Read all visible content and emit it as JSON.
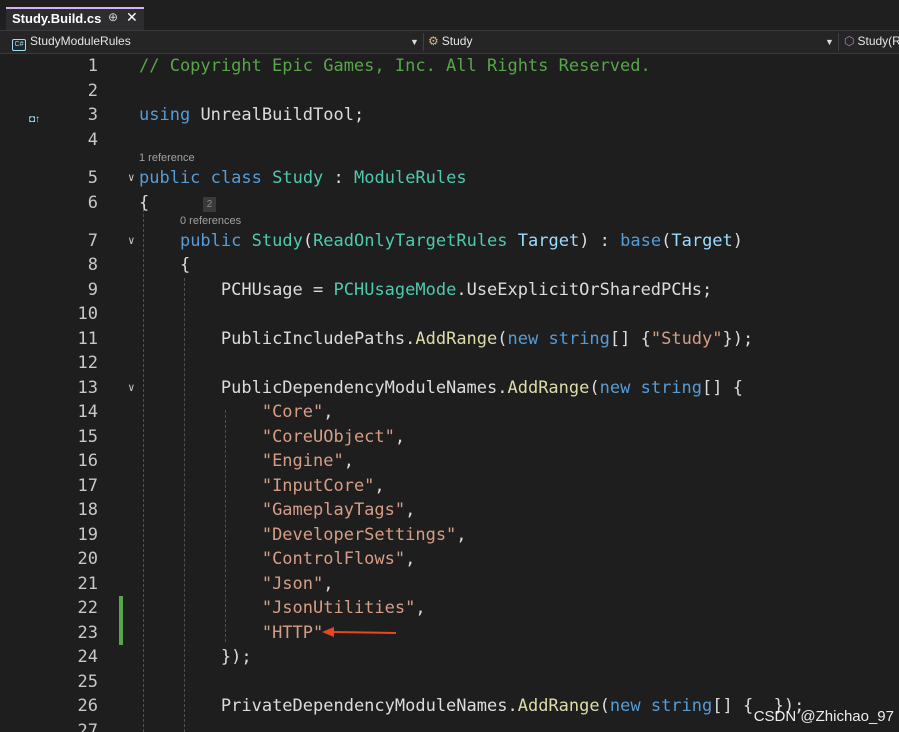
{
  "tab": {
    "title": "Study.Build.cs",
    "pin_glyph": "⊕",
    "close_glyph": "✕"
  },
  "navbar": {
    "project": "StudyModuleRules",
    "scope": "Study",
    "member": "Study(R"
  },
  "codelens": {
    "class_refs": "1 reference",
    "ctor_refs": "0 references",
    "hint_badge": "2"
  },
  "line_numbers": [
    "1",
    "2",
    "3",
    "4",
    "5",
    "6",
    "7",
    "8",
    "9",
    "10",
    "11",
    "12",
    "13",
    "14",
    "15",
    "16",
    "17",
    "18",
    "19",
    "20",
    "21",
    "22",
    "23",
    "24",
    "25",
    "26",
    "27"
  ],
  "code_lines": [
    "// Copyright Epic Games, Inc. All Rights Reserved.",
    "",
    "using UnrealBuildTool;",
    "",
    "public class Study : ModuleRules",
    "{",
    "    public Study(ReadOnlyTargetRules Target) : base(Target)",
    "    {",
    "        PCHUsage = PCHUsageMode.UseExplicitOrSharedPCHs;",
    "",
    "        PublicIncludePaths.AddRange(new string[] {\"Study\"});",
    "",
    "        PublicDependencyModuleNames.AddRange(new string[] {",
    "            \"Core\",",
    "            \"CoreUObject\",",
    "            \"Engine\",",
    "            \"InputCore\",",
    "            \"GameplayTags\",",
    "            \"DeveloperSettings\",",
    "            \"ControlFlows\",",
    "            \"Json\",",
    "            \"JsonUtilities\",",
    "            \"HTTP\"",
    "        });",
    "",
    "        PrivateDependencyModuleNames.AddRange(new string[] {  });",
    ""
  ],
  "colors": {
    "comment": "#57a64a",
    "keyword": "#569cd6",
    "type": "#4ec9b0",
    "method": "#dcdcaa",
    "string": "#d69d85",
    "parameter": "#9cdcfe",
    "plain": "#dcdcdc",
    "arrow": "#e8481f",
    "change_bar": "#57a64a"
  },
  "icons": {
    "bookmark": "bookmark-icon",
    "arrow": "red-arrow-annotation-icon"
  },
  "watermark": "CSDN @Zhichao_97"
}
